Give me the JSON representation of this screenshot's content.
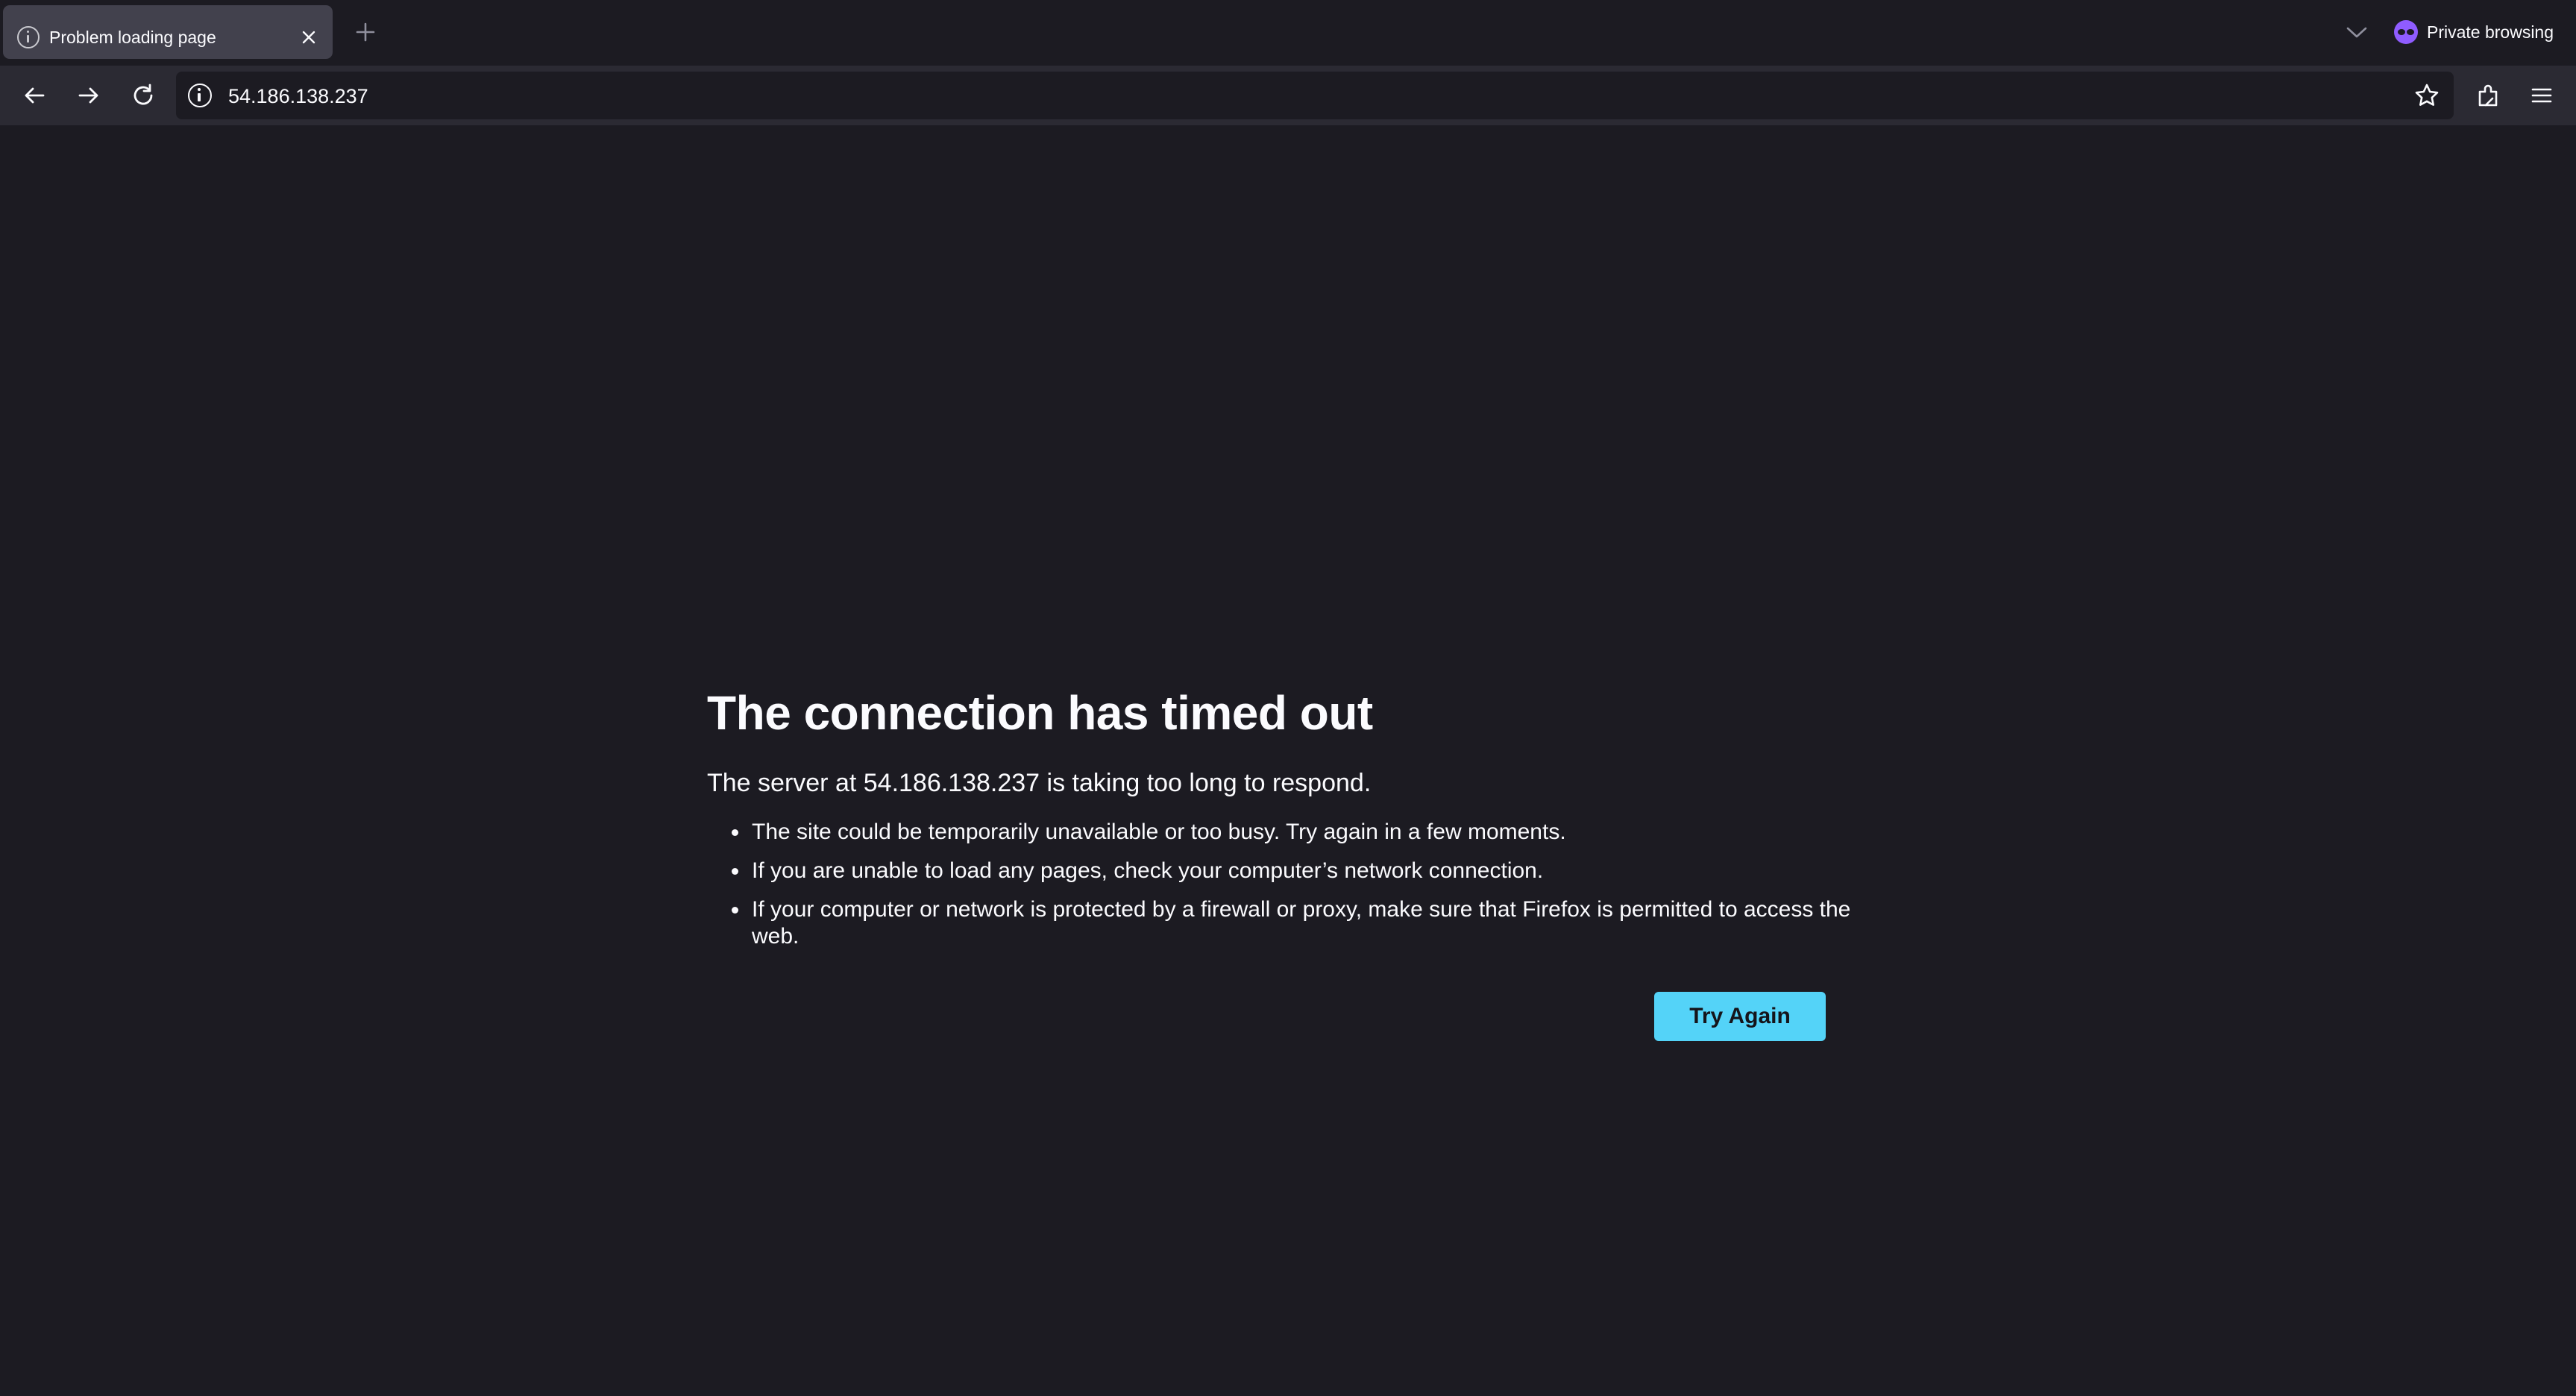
{
  "browser": {
    "tab": {
      "title": "Problem loading page",
      "icon": "info-icon"
    },
    "private_label": "Private browsing",
    "url": "54.186.138.237"
  },
  "error": {
    "title": "The connection has timed out",
    "description": "The server at 54.186.138.237 is taking too long to respond.",
    "suggestions": [
      "The site could be temporarily unavailable or too busy. Try again in a few moments.",
      "If you are unable to load any pages, check your computer’s network connection.",
      "If your computer or network is protected by a firewall or proxy, make sure that Firefox is permitted to access the web."
    ],
    "button_label": "Try Again"
  },
  "colors": {
    "background": "#1c1b22",
    "toolbar": "#2b2a33",
    "accent_button": "#54d3f8",
    "private_accent": "#8f5cff"
  }
}
